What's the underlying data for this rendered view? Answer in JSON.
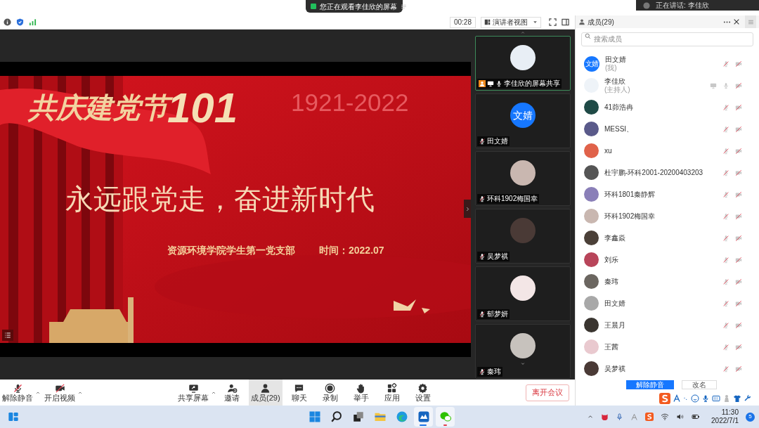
{
  "top_banner": {
    "text": "您正在观看李佳欣的屏幕"
  },
  "speaking": {
    "text": "正在讲话: 李佳欣"
  },
  "toolbar": {
    "timer": "00:28",
    "view_button": "演讲者视图"
  },
  "slide": {
    "title": "共庆建党节",
    "number": "101",
    "years": "1921-2022",
    "headline": "永远跟党走，奋进新时代",
    "organizer": "资源环境学院学生第一党支部",
    "date": "时间：2022.07"
  },
  "video_tiles": [
    {
      "name": "李佳欣的屏幕共享",
      "kind": "share",
      "selected": true,
      "color": "#e8eef5"
    },
    {
      "name": "田文婧",
      "kind": "person",
      "initials": "文婧",
      "selected": false,
      "color": "#1677ff"
    },
    {
      "name": "环科1902梅国幸",
      "kind": "person",
      "selected": false,
      "color": "#c9b7b0"
    },
    {
      "name": "吴梦祺",
      "kind": "person",
      "selected": false,
      "color": "#4a3a36"
    },
    {
      "name": "郁梦妍",
      "kind": "person",
      "selected": false,
      "color": "#f3e6e6"
    },
    {
      "name": "秦玮",
      "kind": "person",
      "selected": false,
      "color": "#c7c2bd"
    }
  ],
  "members_panel": {
    "title": "成员(29)",
    "search_placeholder": "搜索成员",
    "members": [
      {
        "name": "田文婧",
        "note": "(我)",
        "initials": "文婧",
        "color": "#1677ff",
        "muted": true,
        "sharing": false
      },
      {
        "name": "李佳欣",
        "note": "(主持人)",
        "color": "#eef3f8",
        "muted": false,
        "sharing": true
      },
      {
        "name": "41茆浩冉",
        "color": "#1f4a46",
        "muted": true,
        "sharing": false
      },
      {
        "name": "MESSI、",
        "color": "#5a5a8a",
        "muted": true,
        "sharing": false
      },
      {
        "name": "xu",
        "color": "#e0624a",
        "muted": true,
        "sharing": false
      },
      {
        "name": "杜宇鹏-环科2001-20200403203",
        "color": "#555555",
        "muted": true,
        "sharing": false
      },
      {
        "name": "环科1801秦静辉",
        "color": "#8a7fb8",
        "muted": true,
        "sharing": false
      },
      {
        "name": "环科1902梅国幸",
        "color": "#c9b7b0",
        "muted": true,
        "sharing": false
      },
      {
        "name": "李鑫焱",
        "color": "#4b4038",
        "muted": true,
        "sharing": false
      },
      {
        "name": "刘乐",
        "color": "#b8455a",
        "muted": true,
        "sharing": false
      },
      {
        "name": "秦玮",
        "color": "#6b6660",
        "muted": true,
        "sharing": false
      },
      {
        "name": "田文婧",
        "color": "#a8a8a8",
        "muted": true,
        "sharing": false
      },
      {
        "name": "王晨月",
        "color": "#3a3530",
        "muted": true,
        "sharing": false
      },
      {
        "name": "王茜",
        "color": "#e9c9cf",
        "muted": true,
        "sharing": false
      },
      {
        "name": "吴梦祺",
        "color": "#4a3a36",
        "muted": true,
        "sharing": false
      }
    ],
    "buttons": [
      "解除静音",
      "改名"
    ]
  },
  "bottom_toolbar": {
    "items": [
      {
        "label": "解除静音",
        "kind": "mic",
        "caret": true,
        "selected": false
      },
      {
        "label": "开启视频",
        "kind": "video",
        "caret": true,
        "selected": false
      },
      {
        "label": "共享屏幕",
        "kind": "share",
        "caret": true,
        "selected": false
      },
      {
        "label": "邀请",
        "kind": "invite",
        "caret": false,
        "selected": false
      },
      {
        "label": "成员(29)",
        "kind": "members",
        "caret": false,
        "selected": true
      },
      {
        "label": "聊天",
        "kind": "chat",
        "caret": false,
        "selected": false
      },
      {
        "label": "录制",
        "kind": "record",
        "caret": false,
        "selected": false
      },
      {
        "label": "举手",
        "kind": "hand",
        "caret": false,
        "selected": false
      },
      {
        "label": "应用",
        "kind": "apps",
        "caret": false,
        "selected": false
      },
      {
        "label": "设置",
        "kind": "settings",
        "caret": false,
        "selected": false
      }
    ],
    "leave_button": "离开会议"
  },
  "taskbar": {
    "apps": [
      {
        "kind": "start",
        "active": false,
        "alert": false
      },
      {
        "kind": "search",
        "active": false,
        "alert": false
      },
      {
        "kind": "taskview",
        "active": false,
        "alert": false
      },
      {
        "kind": "folder",
        "active": false,
        "alert": false
      },
      {
        "kind": "browser",
        "active": false,
        "alert": false
      },
      {
        "kind": "meeting",
        "active": true,
        "alert": false
      },
      {
        "kind": "chat",
        "active": false,
        "alert": true
      }
    ],
    "time": "11:30",
    "date": "2022/7/1",
    "notification_count": "5"
  }
}
